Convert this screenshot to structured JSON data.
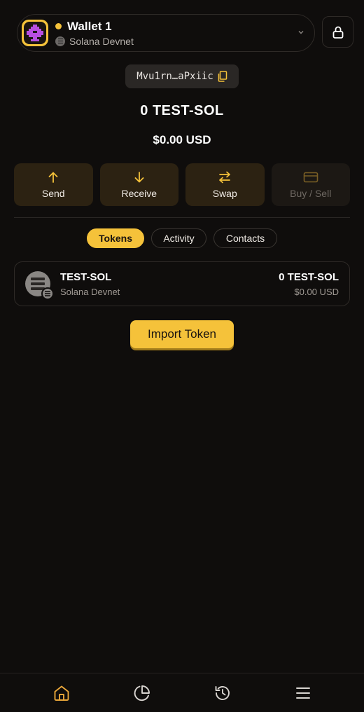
{
  "header": {
    "wallet_name": "Wallet 1",
    "network": "Solana Devnet",
    "status_color": "#f5c23a"
  },
  "address": {
    "short": "Mvu1rn…aPxiic"
  },
  "balance": {
    "amount": "0 TEST-SOL",
    "usd": "$0.00 USD"
  },
  "actions": [
    {
      "label": "Send",
      "icon": "arrow-up-icon",
      "enabled": true
    },
    {
      "label": "Receive",
      "icon": "arrow-down-icon",
      "enabled": true
    },
    {
      "label": "Swap",
      "icon": "swap-icon",
      "enabled": true
    },
    {
      "label": "Buy / Sell",
      "icon": "card-icon",
      "enabled": false
    }
  ],
  "tabs": [
    {
      "label": "Tokens",
      "active": true
    },
    {
      "label": "Activity",
      "active": false
    },
    {
      "label": "Contacts",
      "active": false
    }
  ],
  "tokens": [
    {
      "name": "TEST-SOL",
      "network": "Solana Devnet",
      "amount": "0 TEST-SOL",
      "usd": "$0.00 USD"
    }
  ],
  "import_label": "Import Token",
  "nav": [
    {
      "icon": "home-icon",
      "active": true
    },
    {
      "icon": "pie-chart-icon",
      "active": false
    },
    {
      "icon": "history-icon",
      "active": false
    },
    {
      "icon": "menu-icon",
      "active": false
    }
  ],
  "colors": {
    "accent": "#f5c23a",
    "background": "#0f0d0c",
    "action_bg": "#2c2212"
  }
}
